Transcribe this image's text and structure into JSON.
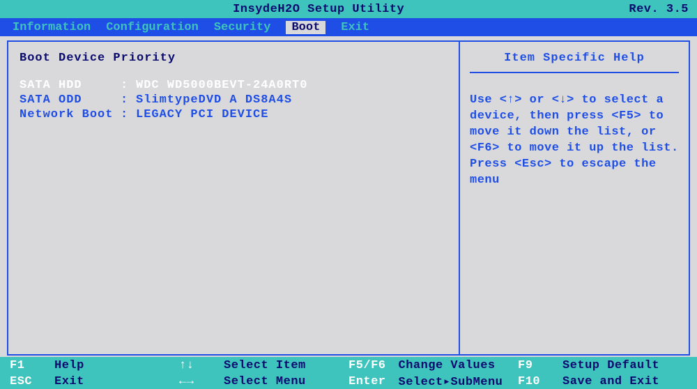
{
  "header": {
    "title": "InsydeH2O Setup Utility",
    "revision": "Rev. 3.5"
  },
  "menu": {
    "items": [
      {
        "label": "Information",
        "active": false
      },
      {
        "label": "Configuration",
        "active": false
      },
      {
        "label": "Security",
        "active": false
      },
      {
        "label": "Boot",
        "active": true
      },
      {
        "label": "Exit",
        "active": false
      }
    ]
  },
  "main": {
    "title": "Boot Device Priority",
    "rows": [
      {
        "label": "SATA HDD",
        "value": "WDC WD5000BEVT-24A0RT0",
        "selected": true
      },
      {
        "label": "SATA ODD",
        "value": "SlimtypeDVD A DS8A4S",
        "selected": false
      },
      {
        "label": "Network Boot",
        "value": "LEGACY PCI DEVICE",
        "selected": false
      }
    ]
  },
  "help": {
    "title": "Item Specific Help",
    "text": "Use <↑> or <↓> to select a device, then press <F5> to move it down the list, or <F6> to move it up the list. Press <Esc> to escape the menu"
  },
  "footer": {
    "f1": {
      "key": "F1",
      "desc": "Help"
    },
    "arrows_v": {
      "key": "↑↓",
      "desc": "Select Item"
    },
    "f5f6": {
      "key": "F5/F6",
      "desc": "Change Values"
    },
    "f9": {
      "key": "F9",
      "desc": "Setup Default"
    },
    "esc": {
      "key": "ESC",
      "desc": "Exit"
    },
    "arrows_h": {
      "key": "←→",
      "desc": "Select Menu"
    },
    "enter": {
      "key": "Enter",
      "desc": "Select▸SubMenu"
    },
    "f10": {
      "key": "F10",
      "desc": "Save and Exit"
    }
  }
}
